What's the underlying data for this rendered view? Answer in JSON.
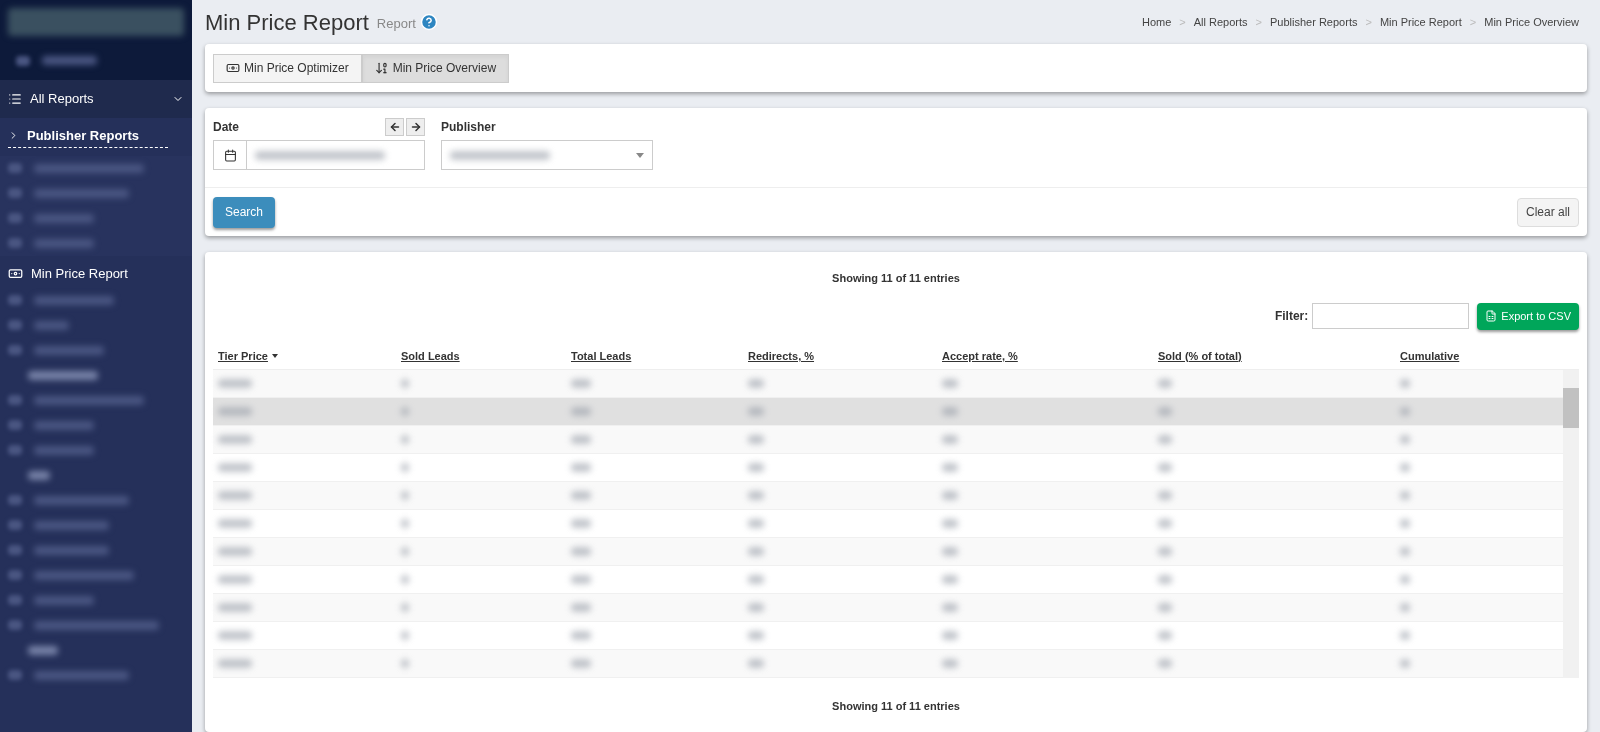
{
  "sidebar": {
    "items": [
      {
        "label": "All Reports",
        "expanded": true,
        "children": [
          {
            "label": "Publisher Reports",
            "selected": true
          },
          {
            "label": "Min Price Report",
            "selected": false
          }
        ]
      }
    ]
  },
  "page": {
    "title": "Min Price Report",
    "subtitle": "Report"
  },
  "breadcrumb": [
    "Home",
    "All Reports",
    "Publisher Reports",
    "Min Price Report",
    "Min Price Overview"
  ],
  "breadcrumb_separator": ">",
  "tabs": [
    {
      "label": "Min Price Optimizer",
      "selected": false
    },
    {
      "label": "Min Price Overview",
      "selected": true
    }
  ],
  "filters": {
    "date_label": "Date",
    "publisher_label": "Publisher",
    "search_button": "Search",
    "clear_button": "Clear all"
  },
  "table": {
    "summary_top": "Showing 11 of 11 entries",
    "filter_label": "Filter:",
    "export_button": "Export to CSV",
    "columns": [
      {
        "label": "Tier Price",
        "sorted": true
      },
      {
        "label": "Sold Leads",
        "sorted": false
      },
      {
        "label": "Total Leads",
        "sorted": false
      },
      {
        "label": "Redirects, %",
        "sorted": false
      },
      {
        "label": "Accept rate, %",
        "sorted": false
      },
      {
        "label": "Sold (% of total)",
        "sorted": false
      },
      {
        "label": "Cumulative",
        "sorted": false
      }
    ],
    "rows": [
      {
        "selected": false
      },
      {
        "selected": true
      },
      {
        "selected": false
      },
      {
        "selected": false
      },
      {
        "selected": false
      },
      {
        "selected": false
      },
      {
        "selected": false
      },
      {
        "selected": false
      },
      {
        "selected": false
      },
      {
        "selected": false
      },
      {
        "selected": false
      }
    ],
    "summary_bottom": "Showing 11 of 11 entries"
  }
}
